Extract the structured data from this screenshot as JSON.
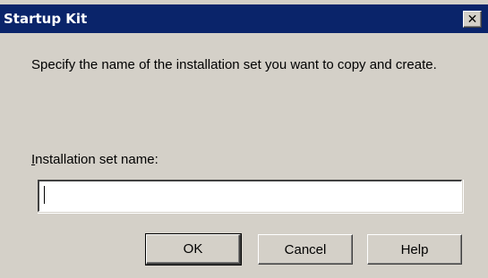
{
  "window": {
    "title": "Startup Kit",
    "close_glyph": "✕",
    "close_icon_name": "close-icon",
    "titlebar_color": "#0a246a",
    "face_color": "#d4d0c8"
  },
  "dialog": {
    "prompt": "Specify the name of the installation set you want to copy and create.",
    "field_label_mnemonic": "I",
    "field_label_rest": "nstallation set name:",
    "field_value": "",
    "field_placeholder": ""
  },
  "buttons": {
    "ok_label": "OK",
    "cancel_label": "Cancel",
    "help_label": "Help"
  }
}
